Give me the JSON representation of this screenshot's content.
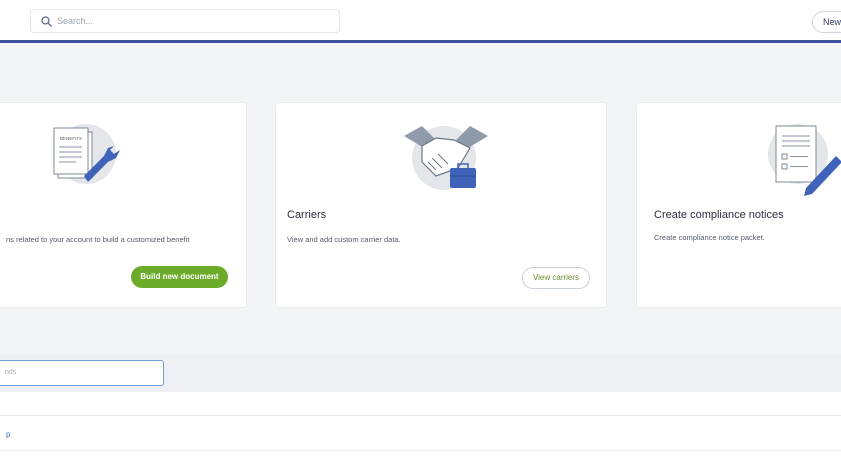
{
  "header": {
    "search_placeholder": "Search...",
    "new_button_label": "New"
  },
  "cards": [
    {
      "title": "",
      "description": "ns related to your account to build a customized benefit",
      "illustration_text": "BENEFITS",
      "button_label": "Build new document"
    },
    {
      "title": "Carriers",
      "description": "View and add custom carrier data.",
      "button_label": "View carriers"
    },
    {
      "title": "Create compliance notices",
      "description": "Create compliance notice packet."
    }
  ],
  "filter": {
    "placeholder": "nds"
  },
  "table": {
    "row_link": "p"
  },
  "colors": {
    "accent_bar": "#3f4f9c",
    "primary_green": "#6cab2a",
    "link_blue": "#3b6fc1"
  }
}
